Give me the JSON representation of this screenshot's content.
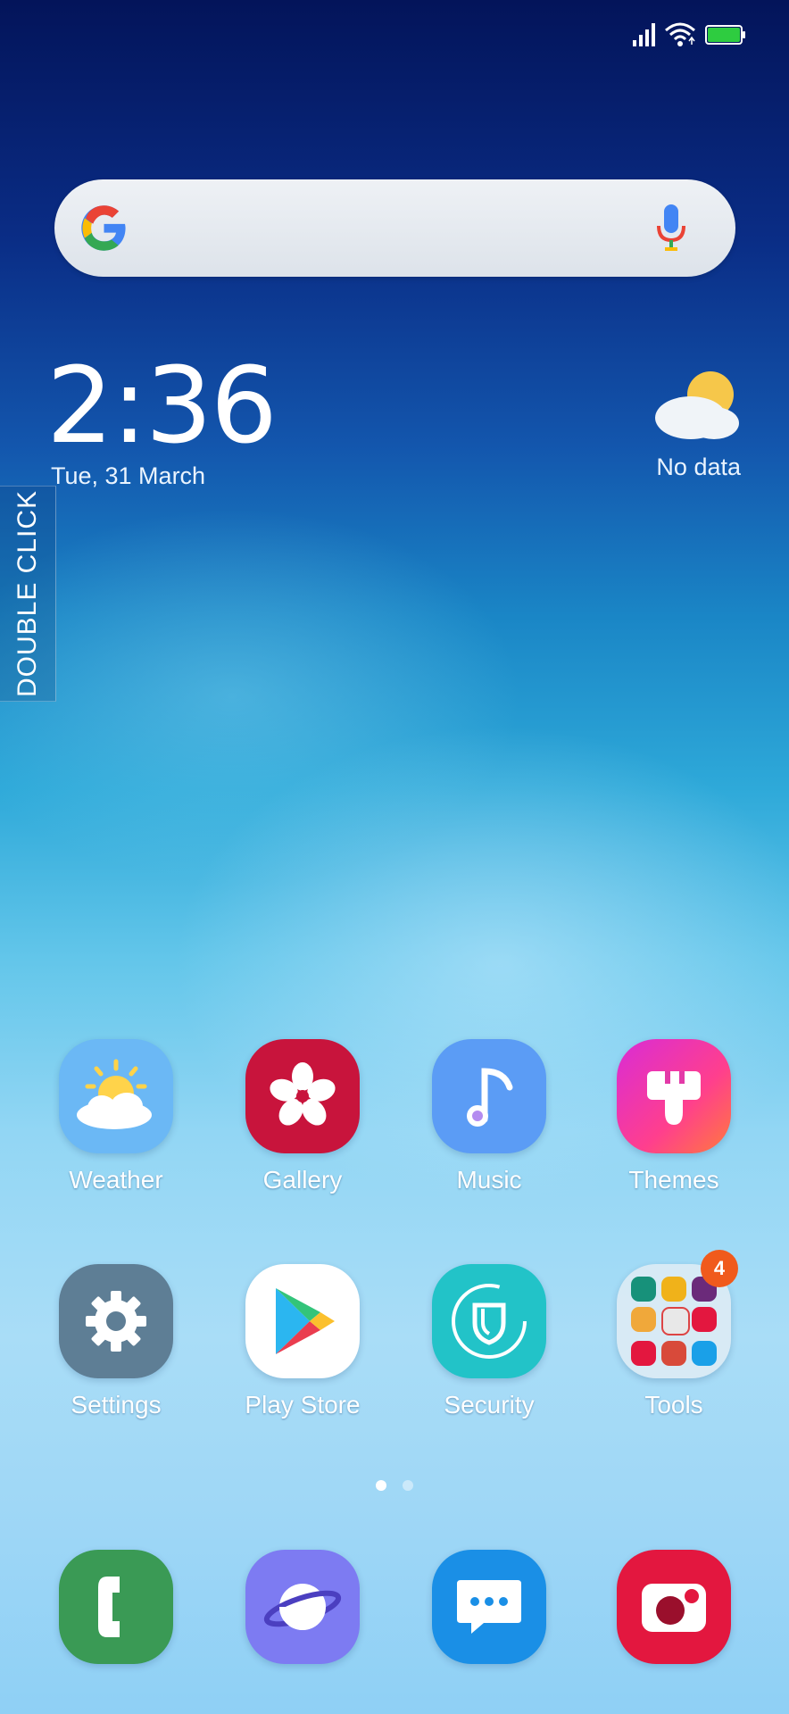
{
  "status_bar": {
    "signal_icon": "signal-icon",
    "wifi_icon": "wifi-icon",
    "battery_icon": "battery-icon",
    "battery_color": "#2ecc40"
  },
  "search": {
    "placeholder": "",
    "logo": "google-logo",
    "mic_icon": "mic-icon"
  },
  "clock": {
    "time": "2:36",
    "date": "Tue, 31 March"
  },
  "weather_widget": {
    "icon": "partly-cloudy-icon",
    "text": "No data"
  },
  "side_tab": {
    "label": "DOUBLE CLICK"
  },
  "apps_row1": [
    {
      "label": "Weather",
      "icon": "weather-icon",
      "color": "#6bb8f5"
    },
    {
      "label": "Gallery",
      "icon": "flower-icon",
      "color": "#c8143c"
    },
    {
      "label": "Music",
      "icon": "music-note-icon",
      "color": "#5b9cf5"
    },
    {
      "label": "Themes",
      "icon": "paintbrush-icon",
      "color": "#e637b8"
    }
  ],
  "apps_row2": [
    {
      "label": "Settings",
      "icon": "gear-icon",
      "color": "#5e7e95"
    },
    {
      "label": "Play Store",
      "icon": "play-store-icon",
      "color": "#ffffff"
    },
    {
      "label": "Security",
      "icon": "shield-icon",
      "color": "#22c3c8"
    },
    {
      "label": "Tools",
      "icon": "folder-icon",
      "color": "#dfeaf3",
      "badge": "4"
    }
  ],
  "page_indicator": {
    "pages": 2,
    "current": 1
  },
  "dock": [
    {
      "name": "phone",
      "icon": "phone-icon",
      "color": "#3a9a55"
    },
    {
      "name": "browser",
      "icon": "internet-icon",
      "color": "#7d7bf2"
    },
    {
      "name": "messages",
      "icon": "message-icon",
      "color": "#1a8fe6"
    },
    {
      "name": "camera",
      "icon": "camera-icon",
      "color": "#e3173f"
    }
  ]
}
